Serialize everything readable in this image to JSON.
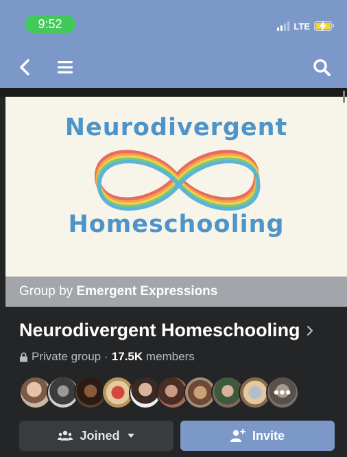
{
  "status_bar": {
    "time": "9:52",
    "network": "LTE",
    "time_pill_color": "#42c85b",
    "battery_color": "#f5d33b"
  },
  "nav": {
    "back_icon": "chevron-left-icon",
    "menu_icon": "hamburger-menu-icon",
    "search_icon": "search-icon",
    "bar_color": "#7b98c9"
  },
  "cover": {
    "title_top": "Neurodivergent",
    "title_bottom": "Homeschooling",
    "text_color": "#4e94c8",
    "background": "#f7f4ea"
  },
  "group_by": {
    "prefix": "Group by",
    "owner": "Emergent Expressions"
  },
  "group": {
    "name": "Neurodivergent Homeschooling",
    "privacy": "Private group",
    "separator": "·",
    "member_count": "17.5K",
    "member_label": "members"
  },
  "members_preview": {
    "avatar_count": 10,
    "more_label": "•••"
  },
  "actions": {
    "joined_label": "Joined",
    "invite_label": "Invite",
    "accent": "#7b98c9"
  }
}
